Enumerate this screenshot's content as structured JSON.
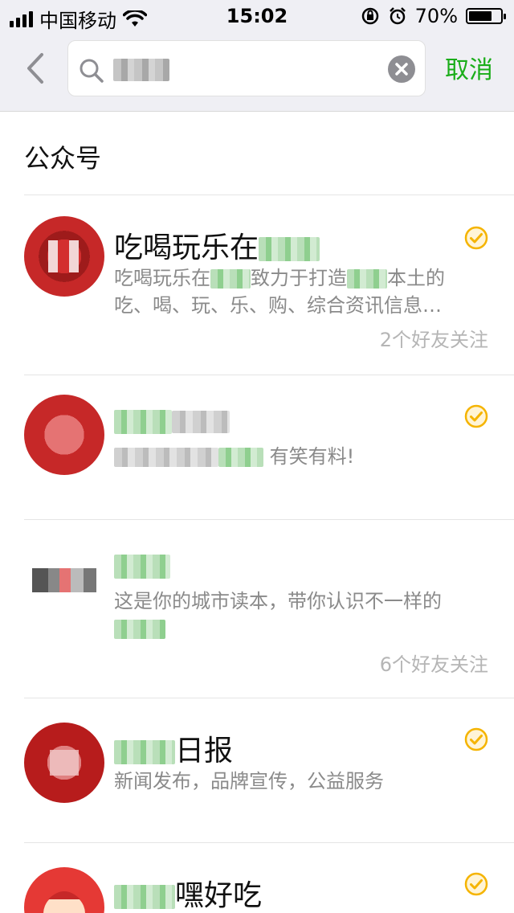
{
  "status_bar": {
    "carrier": "中国移动",
    "time": "15:02",
    "battery": "70%"
  },
  "search": {
    "placeholder": "",
    "cancel_label": "取消"
  },
  "section": {
    "title": "公众号"
  },
  "results": [
    {
      "title_prefix": "吃喝玩乐在",
      "desc_line1_a": "吃喝玩乐在",
      "desc_line1_b": "致力于打造",
      "desc_line1_c": "本土的",
      "desc_line2": "吃、喝、玩、乐、购、综合资讯信息…",
      "follow_text": "2个好友关注",
      "verified": true
    },
    {
      "desc_suffix": "有笑有料!",
      "verified": true
    },
    {
      "desc_line1": "这是你的城市读本，带你认识不一样的",
      "follow_text": "6个好友关注",
      "verified": false
    },
    {
      "title_suffix": "日报",
      "desc": "新闻发布，品牌宣传，公益服务",
      "verified": true
    },
    {
      "title_suffix": "嘿好吃",
      "verified": true
    }
  ],
  "colors": {
    "accent_green": "#1aad19",
    "verified_gold": "#f5b400",
    "avatar_red": "#b71c1c"
  },
  "icons": {
    "back": "chevron-left-icon",
    "search": "search-icon",
    "clear": "clear-icon",
    "verified": "verified-check-icon"
  }
}
